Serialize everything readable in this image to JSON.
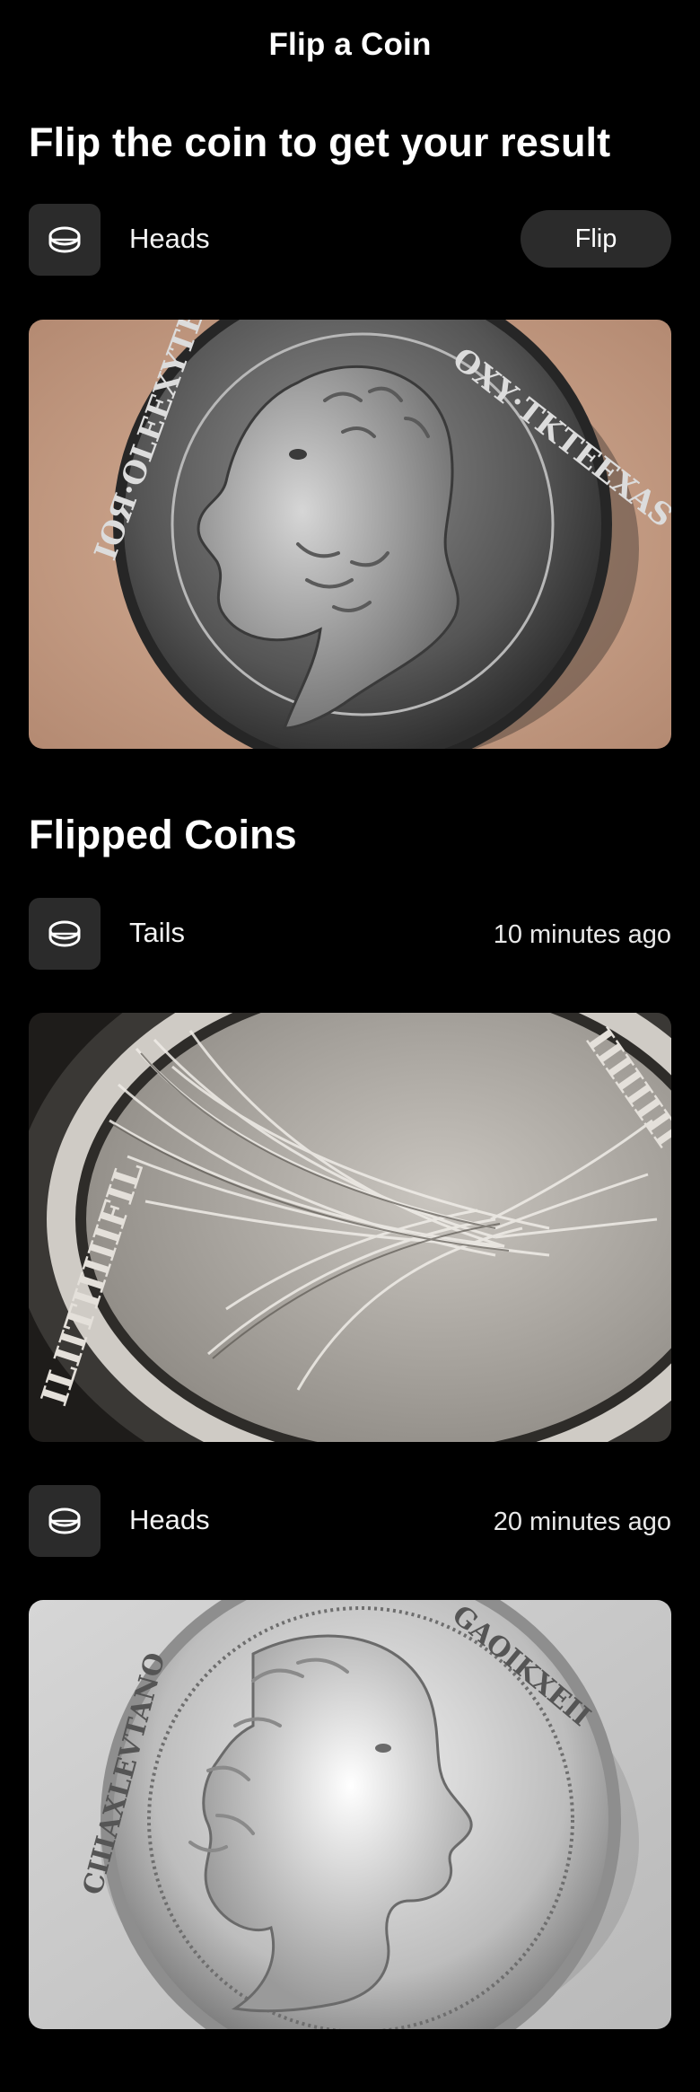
{
  "header": {
    "title": "Flip a Coin"
  },
  "main": {
    "heading": "Flip the coin to get your result",
    "current": {
      "result": "Heads",
      "icon": "coin-icon",
      "flip_label": "Flip"
    },
    "current_image": {
      "alt": "Heads"
    }
  },
  "history": {
    "heading": "Flipped Coins",
    "items": [
      {
        "result": "Tails",
        "time": "10 minutes ago",
        "icon": "coin-icon"
      },
      {
        "result": "Heads",
        "time": "20 minutes ago",
        "icon": "coin-icon"
      }
    ]
  }
}
